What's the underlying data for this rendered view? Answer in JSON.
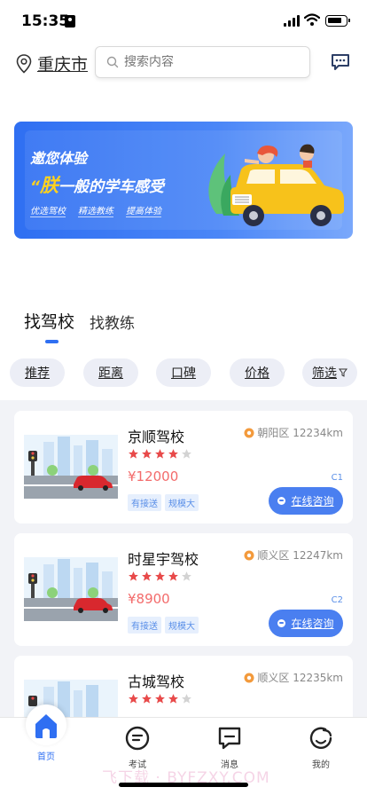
{
  "status_bar": {
    "time": "15:35"
  },
  "header": {
    "city": "重庆市",
    "search_placeholder": "搜索内容"
  },
  "banner": {
    "title": "邀您体验",
    "slogan_accent": "朕",
    "slogan_rest": "一般的学车感受",
    "tags": [
      "优选驾校",
      "精选教练",
      "提高体验"
    ]
  },
  "tabs": [
    {
      "label": "找驾校",
      "active": true
    },
    {
      "label": "找教练",
      "active": false
    }
  ],
  "filters": [
    "推荐",
    "距离",
    "口碑",
    "价格",
    "筛选"
  ],
  "schools": [
    {
      "name": "京顺驾校",
      "rating": 4,
      "rating_max": 5,
      "price": "¥12000",
      "tags": [
        "有接送",
        "规模大"
      ],
      "district": "朝阳区",
      "distance": "12234km",
      "license": "C1",
      "action": "在线咨询"
    },
    {
      "name": "时星宇驾校",
      "rating": 4,
      "rating_max": 5,
      "price": "¥8900",
      "tags": [
        "有接送",
        "规模大"
      ],
      "district": "顺义区",
      "distance": "12247km",
      "license": "C2",
      "action": "在线咨询"
    },
    {
      "name": "古城驾校",
      "rating": 4,
      "rating_max": 5,
      "price": "",
      "tags": [],
      "district": "顺义区",
      "distance": "12235km",
      "license": "",
      "action": ""
    }
  ],
  "bottom_nav": [
    {
      "label": "首页",
      "icon": "home-icon",
      "active": true
    },
    {
      "label": "考试",
      "icon": "exam-icon",
      "active": false
    },
    {
      "label": "消息",
      "icon": "message-icon",
      "active": false
    },
    {
      "label": "我的",
      "icon": "profile-icon",
      "active": false
    }
  ],
  "watermark": "飞下载 · BYFZXY.COM",
  "colors": {
    "primary": "#2f6ff2",
    "price": "#f36b6b",
    "star": "#e84a4a",
    "tag": "#5a8fe8"
  }
}
